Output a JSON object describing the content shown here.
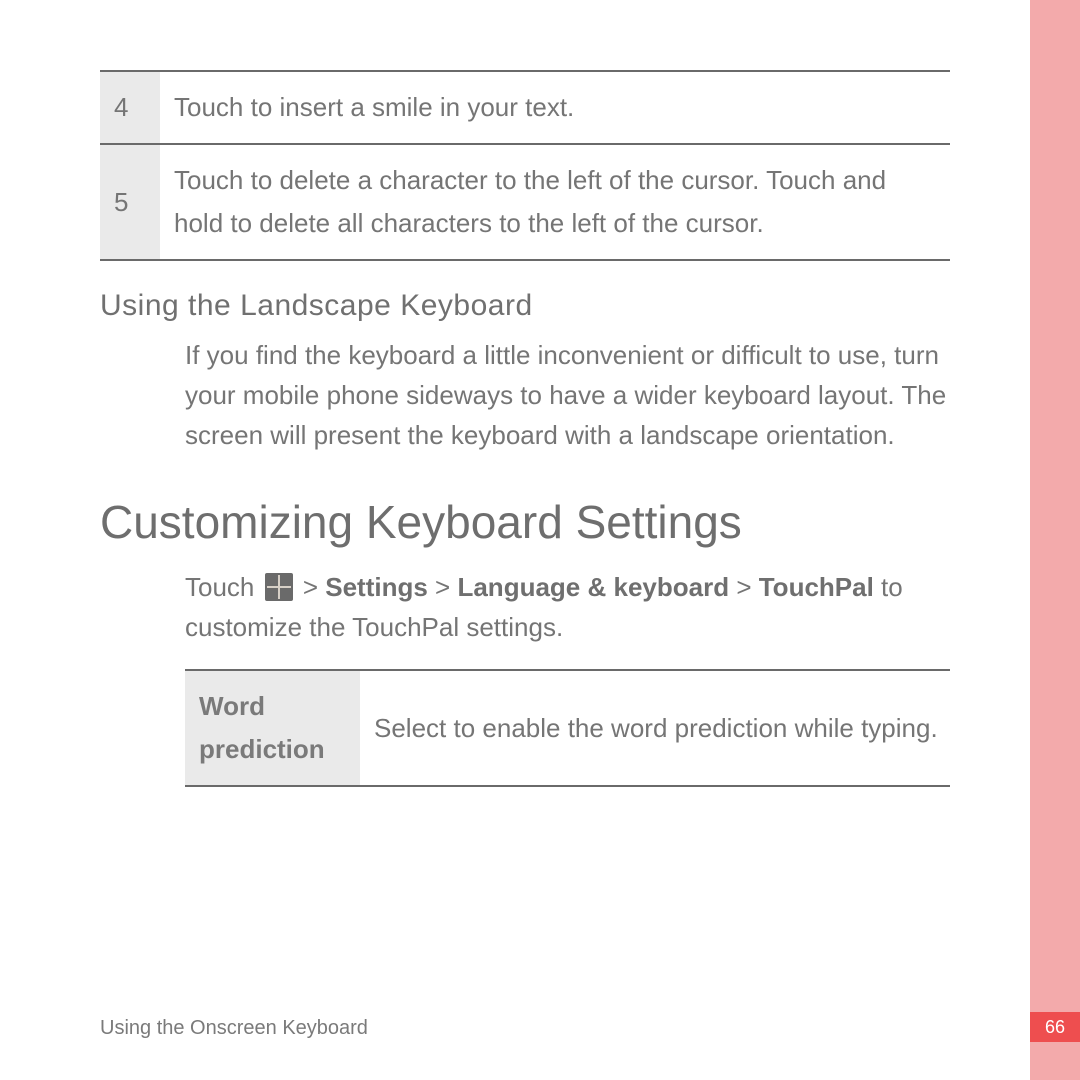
{
  "footer": {
    "text": "Using the Onscreen Keyboard"
  },
  "page": {
    "number": "66"
  },
  "top_table": {
    "rows": [
      {
        "num": "4",
        "text": "Touch to insert a smile in your text."
      },
      {
        "num": "5",
        "text": "Touch to delete a character to the left of the cursor. Touch and hold to delete all characters to the left of the cursor."
      }
    ]
  },
  "subhead1": "Using  the  Landscape  Keyboard",
  "para1": "If you find the keyboard a little inconvenient or difficult to use, turn your mobile phone sideways to have a wider keyboard layout. The screen will present the keyboard with a landscape orientation.",
  "section_heading": "Customizing Keyboard Settings",
  "para2_a": "Touch ",
  "para2_b": " > ",
  "nav1": "Settings",
  "nav2": "Language & keyboard",
  "nav3": "TouchPal",
  "para2_c": " to customize the TouchPal settings.",
  "settings_table": {
    "rows": [
      {
        "label": "Word prediction",
        "text": "Select to enable the word prediction while typing."
      }
    ]
  }
}
